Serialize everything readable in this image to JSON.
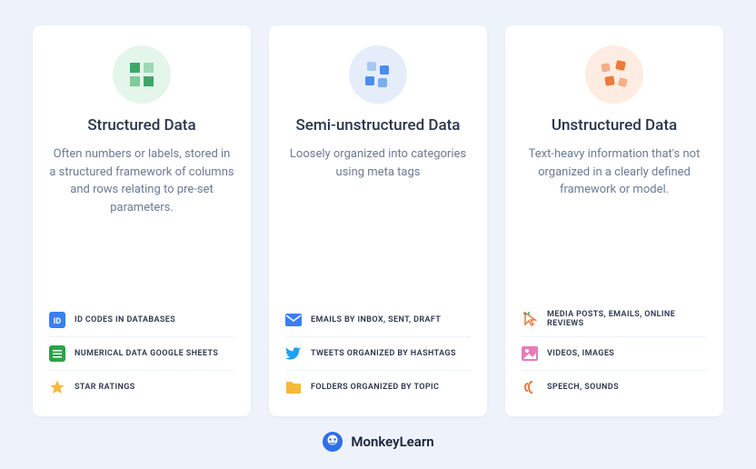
{
  "cards": [
    {
      "title": "Structured Data",
      "description": "Often numbers or labels, stored in a structured framework of columns and rows relating to pre-set parameters.",
      "icon_bg": "#e4f5ea",
      "icon_colors": [
        "#3fa66a",
        "#9dd8b4",
        "#7ecb9b",
        "#3fa66a"
      ],
      "examples": [
        {
          "label": "ID CODES IN DATABASES",
          "icon": "id-icon"
        },
        {
          "label": "NUMERICAL DATA GOOGLE SHEETS",
          "icon": "sheet-icon"
        },
        {
          "label": "STAR RATINGS",
          "icon": "star-icon"
        }
      ]
    },
    {
      "title": "Semi-unstructured Data",
      "description": "Loosely organized into categories using meta tags",
      "icon_bg": "#e5edfb",
      "icon_colors": [
        "#a8c7f4",
        "#4a8cf0",
        "#4a8cf0",
        "#7aaef2"
      ],
      "examples": [
        {
          "label": "EMAILS BY INBOX, SENT, DRAFT",
          "icon": "mail-icon"
        },
        {
          "label": "TWEETS ORGANIZED BY HASHTAGS",
          "icon": "twitter-icon"
        },
        {
          "label": "FOLDERS ORGANIZED BY TOPIC",
          "icon": "folder-icon"
        }
      ]
    },
    {
      "title": "Unstructured Data",
      "description": "Text-heavy information that's not organized in a clearly defined framework or model.",
      "icon_bg": "#fdece1",
      "icon_colors": [
        "#f2b088",
        "#ec7a3c",
        "#ec7a3c",
        "#f2b088"
      ],
      "examples": [
        {
          "label": "MEDIA POSTS, EMAILS, ONLINE REVIEWS",
          "icon": "cursor-icon"
        },
        {
          "label": "VIDEOS, IMAGES",
          "icon": "image-icon"
        },
        {
          "label": "SPEECH, SOUNDS",
          "icon": "sound-icon"
        }
      ]
    }
  ],
  "footer": {
    "brand": "MonkeyLearn"
  }
}
